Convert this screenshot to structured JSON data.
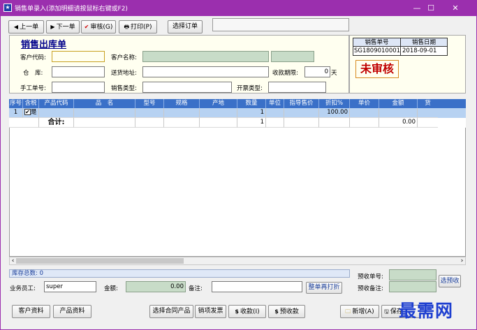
{
  "window": {
    "title": "销售单录入(添加明细请按鼠标右键或F2)",
    "icon_glyph": "★",
    "minimize_glyph": "—",
    "maximize_glyph": "☐",
    "close_glyph": "✕"
  },
  "toolbar": {
    "prev_label": "上一单",
    "next_label": "下一单",
    "audit_label": "审核(G)",
    "print_label": "打印(P)",
    "select_order_label": "选择订单",
    "prev_icon": "◀",
    "next_icon": "▶",
    "audit_icon": "✔",
    "print_icon": "🖶"
  },
  "form": {
    "title": "销售出库单",
    "customer_code_label": "客户代码:",
    "customer_code_value": "",
    "customer_name_label": "客户名称:",
    "customer_name_value": "",
    "warehouse_label": "仓　库:",
    "warehouse_value": "",
    "delivery_address_label": "送货地址:",
    "delivery_address_value": "",
    "payment_term_label": "收款期限:",
    "payment_term_value": "0",
    "payment_term_unit": "天",
    "manual_no_label": "手工单号:",
    "manual_no_value": "",
    "sales_type_label": "销售类型:",
    "sales_type_value": "",
    "invoice_type_label": "开票类型:",
    "invoice_type_value": ""
  },
  "order_info": {
    "number_header": "销售单号",
    "date_header": "销售日期",
    "number_value": "SG1809010001",
    "date_value": "2018-09-01",
    "status": "未审核"
  },
  "grid": {
    "headers": [
      "序号",
      "含税",
      "产品代码",
      "品　名",
      "型号",
      "规格",
      "产地",
      "数量",
      "单位",
      "指导售价",
      "折扣%",
      "单价",
      "金额",
      "货"
    ],
    "row": {
      "index": "1",
      "tax_check": "✔",
      "tax_text": "是",
      "quantity": "1",
      "discount": "100.00"
    },
    "total_label": "合计:",
    "total_quantity": "1",
    "total_amount": "0.00"
  },
  "scroll": {
    "left_arrow": "‹",
    "right_arrow": "›"
  },
  "footer": {
    "stock_total": "库存总数: 0",
    "salesperson_label": "业务员工:",
    "salesperson_value": "super",
    "amount_label": "金额:",
    "amount_value": "0.00",
    "remark_label": "备注:",
    "remark_value": "",
    "reprint_label": "整单再打折",
    "prepay_no_label": "预收单号:",
    "prepay_no_value": "",
    "prepay_remark_label": "预收备注:",
    "prepay_remark_value": "",
    "select_prepay_label": "选预收"
  },
  "bottom_buttons": {
    "customer_info": "客户资料",
    "product_info": "产品资料",
    "select_contract": "选择合同产品",
    "sales_invoice": "销项发票",
    "receipt": "收款(I)",
    "prepay": "预收款",
    "receipt_icon": "$",
    "prepay_icon": "$",
    "new_label": "新增(A)",
    "new_icon": "🗀",
    "save_label": "保存",
    "save_icon": "🖫"
  },
  "watermark": {
    "text": "最需网"
  },
  "colors": {
    "titlebar": "#9b2fae",
    "grid_header": "#3a70c8",
    "status_text": "#c00000"
  }
}
